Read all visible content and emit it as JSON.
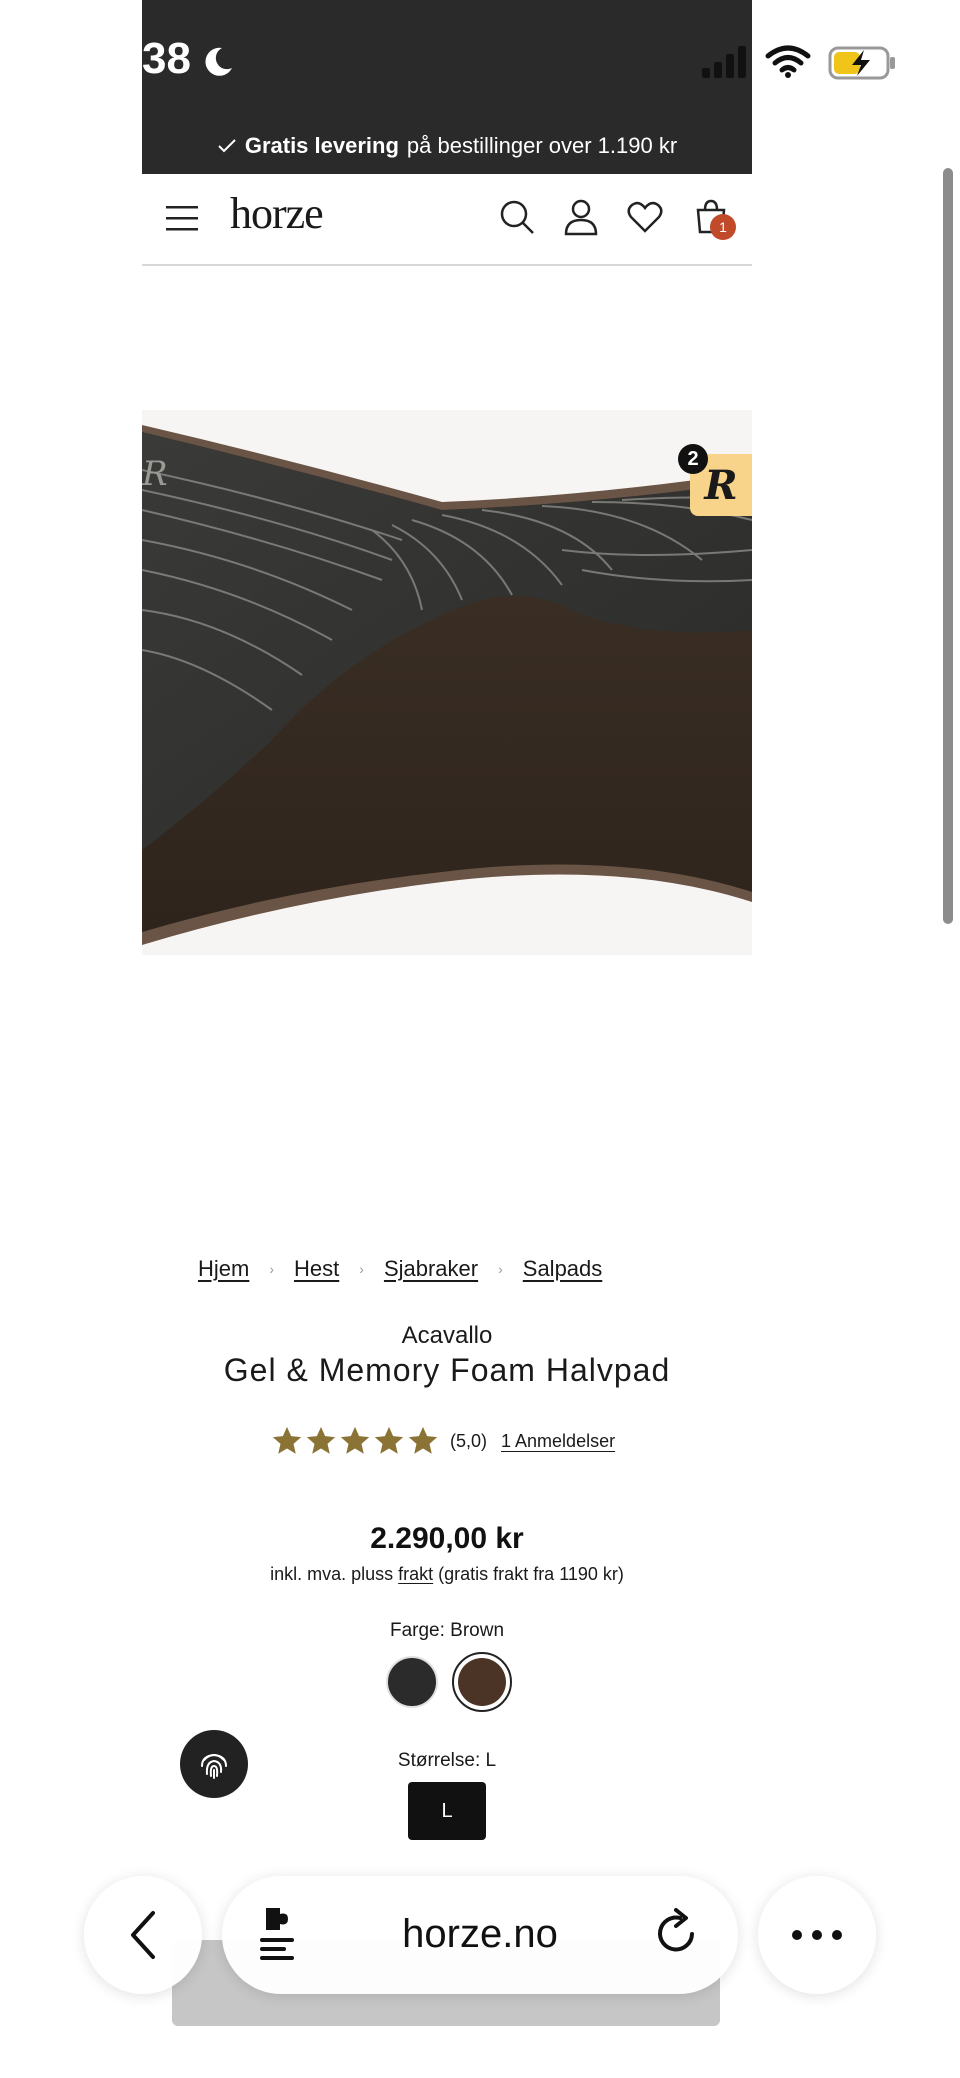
{
  "status_bar": {
    "time": "38",
    "icons": [
      "moon-icon",
      "cellular-signal-icon",
      "wifi-icon",
      "battery-charging-icon"
    ]
  },
  "announcement": {
    "check_icon": "check-icon",
    "bold": "Gratis levering",
    "rest": "på bestillinger over 1.190 kr"
  },
  "header": {
    "logo": "horze",
    "icons": [
      "menu-icon",
      "search-icon",
      "account-icon",
      "heart-icon",
      "cart-icon"
    ],
    "cart_count": "1"
  },
  "image_badge": {
    "letter": "R",
    "count": "2"
  },
  "breadcrumb": [
    "Hjem",
    "Hest",
    "Sjabraker",
    "Salpads"
  ],
  "product": {
    "brand": "Acavallo",
    "title": "Gel & Memory Foam Halvpad",
    "rating": {
      "stars": 5,
      "score": "(5,0)",
      "reviews": "1 Anmeldelser"
    },
    "price": "2.290,00 kr",
    "vat_prefix": "inkl. mva. pluss",
    "vat_link": "frakt",
    "vat_suffix": "(gratis frakt fra 1190 kr)",
    "color_label": "Farge: Brown",
    "colors": [
      {
        "name": "Black",
        "hex": "#2b2b2b",
        "selected": false
      },
      {
        "name": "Brown",
        "hex": "#4b3426",
        "selected": true
      }
    ],
    "size_label": "Størrelse: L",
    "sizes": [
      "L"
    ]
  },
  "toolbar": {
    "url": "horze.no"
  },
  "colors": {
    "dark_bar": "#2a2a2a",
    "star": "#8a7335",
    "cart_badge": "#c04a2a",
    "badge_yellow": "#f7d48a"
  }
}
